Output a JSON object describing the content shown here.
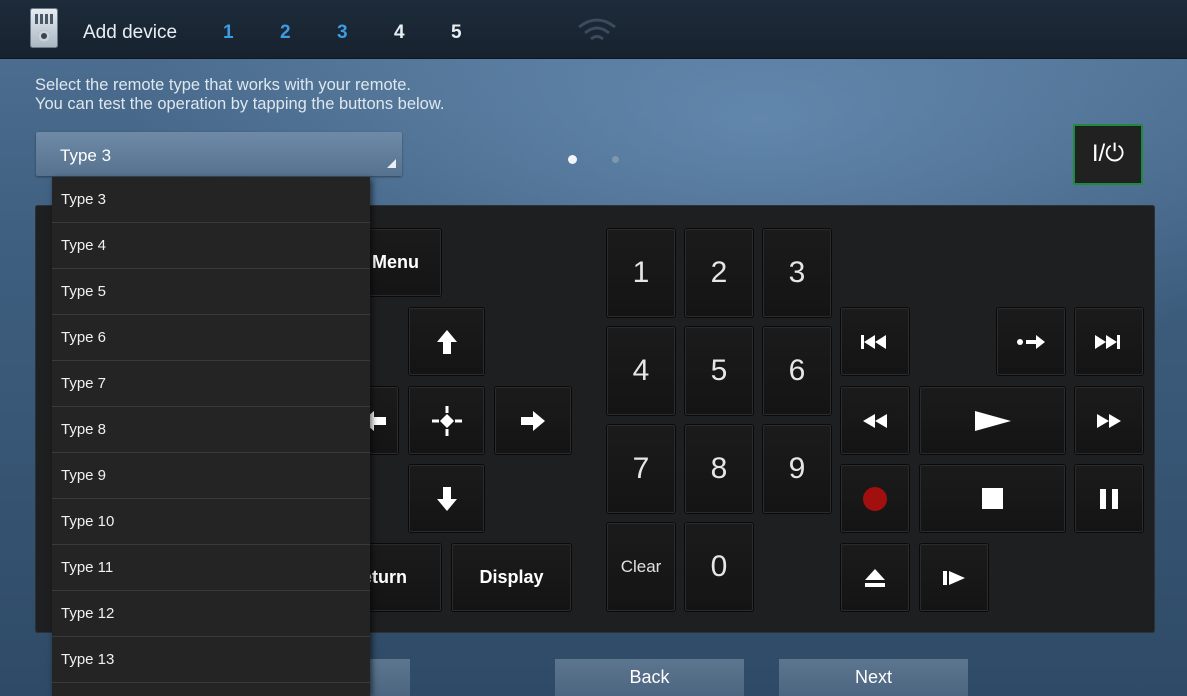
{
  "header": {
    "title": "Add device",
    "steps": [
      "1",
      "2",
      "3",
      "4",
      "5"
    ],
    "completed_steps": 3
  },
  "instructions": {
    "line1": "Select the remote type that works with your remote.",
    "line2": "You can test the operation by tapping the buttons below."
  },
  "type_select": {
    "selected": "Type 3",
    "options": [
      "Type 3",
      "Type 4",
      "Type 5",
      "Type 6",
      "Type 7",
      "Type 8",
      "Type 9",
      "Type 10",
      "Type 11",
      "Type 12",
      "Type 13"
    ]
  },
  "pager": {
    "pages": 2,
    "current": 1
  },
  "power_button": {
    "label": "I/⏻"
  },
  "remote": {
    "menu": "Menu",
    "return": "Return",
    "display": "Display",
    "clear": "Clear",
    "digits": [
      "1",
      "2",
      "3",
      "4",
      "5",
      "6",
      "7",
      "8",
      "9",
      "0"
    ]
  },
  "footer": {
    "back": "Back",
    "next": "Next"
  },
  "colors": {
    "step_done": "#3d9be0",
    "power_border": "#1f8a3c",
    "record": "#a10f0f"
  }
}
